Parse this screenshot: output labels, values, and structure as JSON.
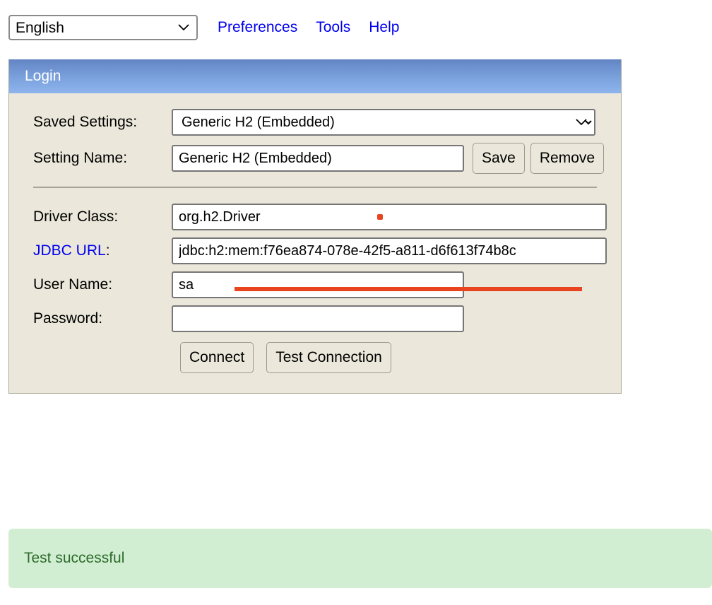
{
  "toolbar": {
    "language_select": {
      "value": "English",
      "options": [
        "English"
      ]
    },
    "links": [
      {
        "label": "Preferences",
        "name": "preferences"
      },
      {
        "label": "Tools",
        "name": "tools"
      },
      {
        "label": "Help",
        "name": "help"
      }
    ]
  },
  "panel": {
    "title": "Login",
    "fields": {
      "saved_settings": {
        "label": "Saved Settings:",
        "value": "Generic H2 (Embedded)",
        "options": [
          "Generic H2 (Embedded)"
        ]
      },
      "setting_name": {
        "label": "Setting Name:",
        "value": "Generic H2 (Embedded)",
        "placeholder": ""
      },
      "driver_class": {
        "label": "Driver Class:",
        "value": "org.h2.Driver",
        "placeholder": ""
      },
      "jdbc_url": {
        "label_link": "JDBC URL",
        "label_colon": ":",
        "value": "jdbc:h2:mem:f76ea874-078e-42f5-a811-d6f613f74b8c",
        "placeholder": ""
      },
      "user_name": {
        "label": "User Name:",
        "value": "sa",
        "placeholder": ""
      },
      "password": {
        "label": "Password:",
        "value": "",
        "placeholder": ""
      }
    },
    "buttons": {
      "save": "Save",
      "remove": "Remove",
      "connect": "Connect",
      "test_connection": "Test Connection"
    }
  },
  "status_banner": {
    "message": "Test successful",
    "type": "success"
  },
  "colors": {
    "link": "#0000ee",
    "panel_background": "#ebe8db",
    "header_gradient_top": "#6384c4",
    "header_gradient_bottom": "#8db4ec",
    "annotation_red": "#e8441f",
    "success_background": "#d2eed2",
    "success_text": "#2d6b2d"
  }
}
